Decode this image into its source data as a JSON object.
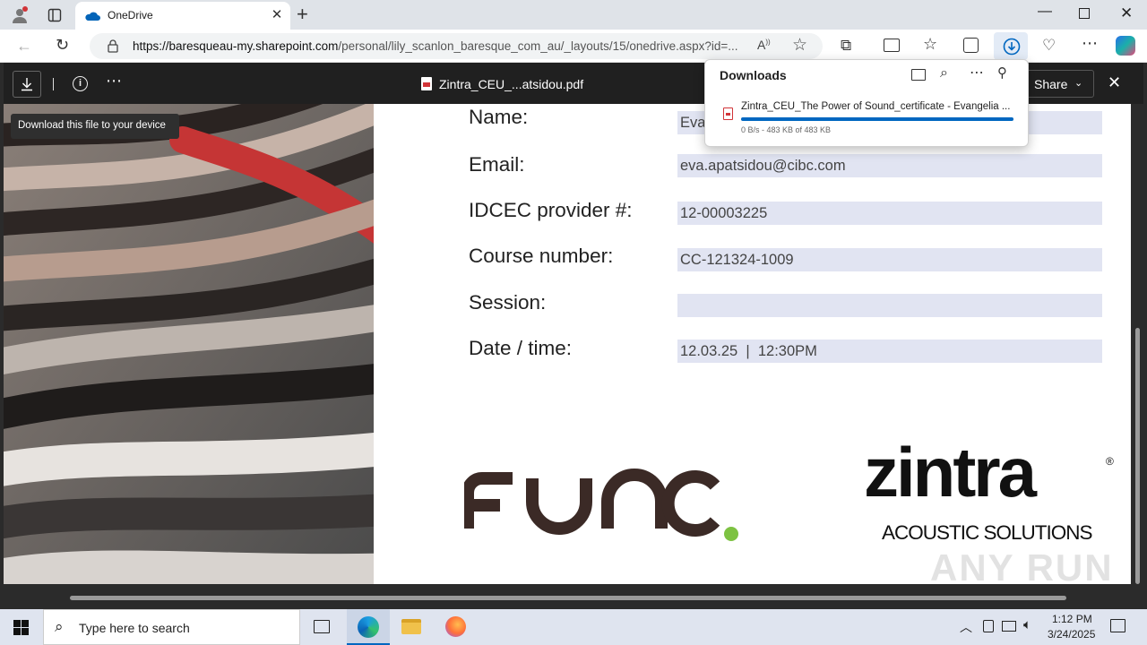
{
  "browser": {
    "tab_title": "OneDrive",
    "url_host": "https://baresqueau-my.sharepoint.com",
    "url_path": "/personal/lily_scanlon_baresque_com_au/_layouts/15/onedrive.aspx?id=..."
  },
  "viewer": {
    "filename": "Zintra_CEU_...atsidou.pdf",
    "share_label": "Share",
    "tooltip": "Download this file to your device"
  },
  "downloads": {
    "title": "Downloads",
    "item_name": "Zintra_CEU_The Power of Sound_certificate - Evangelia ...",
    "item_status": "0 B/s - 483 KB of 483 KB",
    "progress": 1.0
  },
  "certificate": {
    "rows": [
      {
        "label": "Name:",
        "value": "Eva"
      },
      {
        "label": "Email:",
        "value": "eva.apatsidou@cibc.com"
      },
      {
        "label": "IDCEC provider #:",
        "value": "12-00003225"
      },
      {
        "label": "Course number:",
        "value": "CC-121324-1009"
      },
      {
        "label": "Session:",
        "value": ""
      },
      {
        "label": "Date / time:",
        "value": "12.03.25  |  12:30PM"
      }
    ],
    "logo_func": "FUNC",
    "logo_zintra": "zintra",
    "logo_zintra_sub": "ACOUSTIC SOLUTIONS"
  },
  "watermark": "ANY RUN",
  "taskbar": {
    "search_placeholder": "Type here to search",
    "time": "1:12 PM",
    "date": "3/24/2025"
  },
  "colors": {
    "accent": "#0067c0",
    "field_bg": "#e1e4f2",
    "func_dot": "#7dc242",
    "func_brown": "#3b2a26"
  }
}
